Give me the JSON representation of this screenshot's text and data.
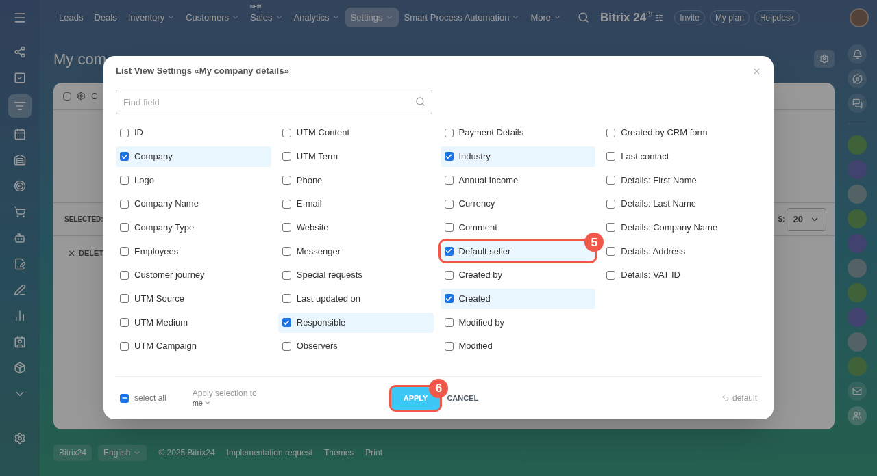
{
  "nav": {
    "items": [
      {
        "label": "Leads",
        "dropdown": false,
        "selected": false
      },
      {
        "label": "Deals",
        "dropdown": false,
        "selected": false
      },
      {
        "label": "Inventory",
        "dropdown": true,
        "selected": false
      },
      {
        "label": "Customers",
        "dropdown": true,
        "selected": false
      },
      {
        "label": "Sales",
        "dropdown": true,
        "selected": false,
        "badge": "NEW"
      },
      {
        "label": "Analytics",
        "dropdown": true,
        "selected": false
      },
      {
        "label": "Settings",
        "dropdown": true,
        "selected": true
      },
      {
        "label": "Smart Process Automation",
        "dropdown": true,
        "selected": false
      },
      {
        "label": "More",
        "dropdown": true,
        "selected": false
      }
    ],
    "logo": "Bitrix 24",
    "buttons": [
      "Invite",
      "My plan",
      "Helpdesk"
    ]
  },
  "page_title": "My com",
  "list": {
    "all_checked": false,
    "header_fragment": "C",
    "selected_label": "SELECTED:",
    "delete_fragment": "DELET",
    "page_size_fragment": "S:",
    "page_size": "20"
  },
  "dialog": {
    "title": "List View Settings «My company details»",
    "search": {
      "placeholder": "Find field"
    },
    "columns": [
      [
        {
          "label": "ID",
          "checked": false
        },
        {
          "label": "Company",
          "checked": true
        },
        {
          "label": "Logo",
          "checked": false
        },
        {
          "label": "Company Name",
          "checked": false
        },
        {
          "label": "Company Type",
          "checked": false
        },
        {
          "label": "Employees",
          "checked": false
        },
        {
          "label": "Customer journey",
          "checked": false
        },
        {
          "label": "UTM Source",
          "checked": false
        },
        {
          "label": "UTM Medium",
          "checked": false
        },
        {
          "label": "UTM Campaign",
          "checked": false
        }
      ],
      [
        {
          "label": "UTM Content",
          "checked": false
        },
        {
          "label": "UTM Term",
          "checked": false
        },
        {
          "label": "Phone",
          "checked": false
        },
        {
          "label": "E-mail",
          "checked": false
        },
        {
          "label": "Website",
          "checked": false
        },
        {
          "label": "Messenger",
          "checked": false
        },
        {
          "label": "Special requests",
          "checked": false
        },
        {
          "label": "Last updated on",
          "checked": false
        },
        {
          "label": "Responsible",
          "checked": true
        },
        {
          "label": "Observers",
          "checked": false
        }
      ],
      [
        {
          "label": "Payment Details",
          "checked": false
        },
        {
          "label": "Industry",
          "checked": true
        },
        {
          "label": "Annual Income",
          "checked": false
        },
        {
          "label": "Currency",
          "checked": false
        },
        {
          "label": "Comment",
          "checked": false
        },
        {
          "label": "Default seller",
          "checked": true,
          "callout": "5"
        },
        {
          "label": "Created by",
          "checked": false
        },
        {
          "label": "Created",
          "checked": true
        },
        {
          "label": "Modified by",
          "checked": false
        },
        {
          "label": "Modified",
          "checked": false
        }
      ],
      [
        {
          "label": "Created by CRM form",
          "checked": false
        },
        {
          "label": "Last contact",
          "checked": false
        },
        {
          "label": "Details: First Name",
          "checked": false
        },
        {
          "label": "Details: Last Name",
          "checked": false
        },
        {
          "label": "Details: Company Name",
          "checked": false
        },
        {
          "label": "Details: Address",
          "checked": false
        },
        {
          "label": "Details: VAT ID",
          "checked": false
        }
      ]
    ],
    "select_all": {
      "label": "select all",
      "indeterminate": true
    },
    "apply_to": {
      "label": "Apply selection to",
      "value": "me"
    },
    "apply": {
      "label": "APPLY",
      "callout": "6"
    },
    "cancel": "CANCEL",
    "reset": "default"
  },
  "footer": {
    "logo": "Bitrix24",
    "language": "English",
    "copyright": "© 2025 Bitrix24",
    "links": [
      "Implementation request",
      "Themes",
      "Print"
    ]
  }
}
